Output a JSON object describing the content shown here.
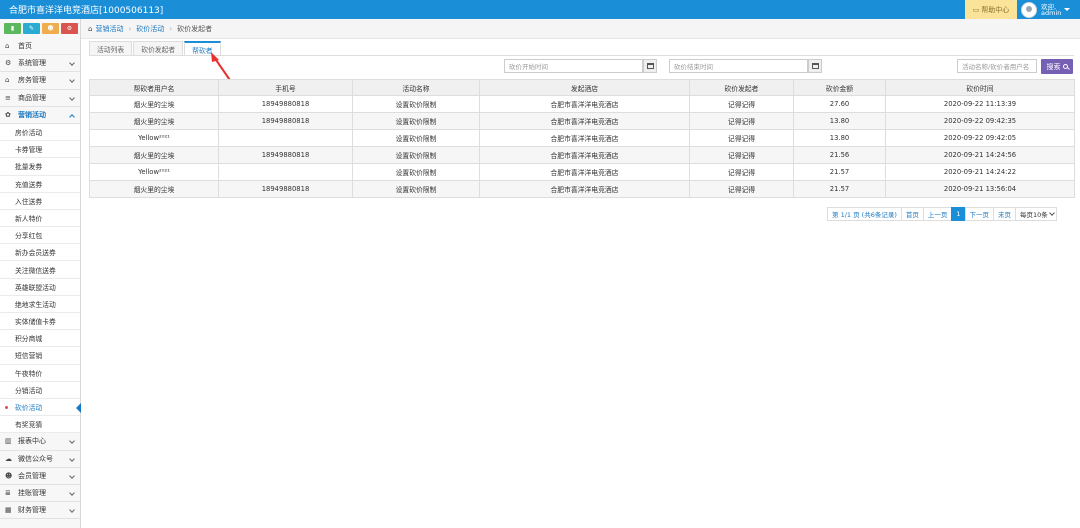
{
  "app": {
    "title": "合肥市喜洋洋电竞酒店[1000506113]"
  },
  "topbar": {
    "help_label": "帮助中心",
    "welcome": "欢迎,",
    "username": "admin"
  },
  "sidebar": {
    "quick_buttons": [
      {
        "icon": "chart-icon",
        "glyph": "▮",
        "color": "#5cb85c"
      },
      {
        "icon": "pencil-icon",
        "glyph": "✎",
        "color": "#2aabd2"
      },
      {
        "icon": "users-icon",
        "glyph": "☻",
        "color": "#f0ad4e"
      },
      {
        "icon": "gears-icon",
        "glyph": "⚙",
        "color": "#d9534f"
      }
    ],
    "top_items": [
      {
        "label": "首页",
        "icon": "home-icon",
        "glyph": "⌂",
        "has_caret": false
      },
      {
        "label": "系统管理",
        "icon": "gear-icon",
        "glyph": "⚙",
        "has_caret": true
      },
      {
        "label": "房务管理",
        "icon": "bank-icon",
        "glyph": "⌂",
        "has_caret": true
      },
      {
        "label": "商品管理",
        "icon": "list-icon",
        "glyph": "≡",
        "has_caret": true
      },
      {
        "label": "营销活动",
        "icon": "gift-icon",
        "glyph": "✿",
        "has_caret": true,
        "active": true
      }
    ],
    "sub_items": [
      {
        "label": "房价活动"
      },
      {
        "label": "卡券管理"
      },
      {
        "label": "批量发券"
      },
      {
        "label": "充值送券"
      },
      {
        "label": "入住送券"
      },
      {
        "label": "新人特价"
      },
      {
        "label": "分享红包"
      },
      {
        "label": "新办会员送券"
      },
      {
        "label": "关注微信送券"
      },
      {
        "label": "英雄联盟活动"
      },
      {
        "label": "绝地求生活动"
      },
      {
        "label": "实体储值卡券"
      },
      {
        "label": "积分商城"
      },
      {
        "label": "短信营销"
      },
      {
        "label": "午夜特价"
      },
      {
        "label": "分销活动"
      },
      {
        "label": "砍价活动",
        "active": true
      },
      {
        "label": "有奖竞猜"
      }
    ],
    "bottom_items": [
      {
        "label": "报表中心",
        "icon": "bar-chart-icon",
        "glyph": "▥",
        "has_caret": true
      },
      {
        "label": "微信公众号",
        "icon": "cloud-icon",
        "glyph": "☁",
        "has_caret": true
      },
      {
        "label": "会员管理",
        "icon": "group-icon",
        "glyph": "☻",
        "has_caret": true
      },
      {
        "label": "挂账管理",
        "icon": "list-icon",
        "glyph": "≣",
        "has_caret": true
      },
      {
        "label": "财务管理",
        "icon": "building-icon",
        "glyph": "▦",
        "has_caret": true
      }
    ]
  },
  "breadcrumb": {
    "items": [
      "营销活动",
      "砍价活动",
      "砍价发起者"
    ]
  },
  "tabs": [
    {
      "label": "活动列表"
    },
    {
      "label": "砍价发起者"
    },
    {
      "label": "帮砍者",
      "active": true
    }
  ],
  "filters": {
    "start_placeholder": "砍价开始时间",
    "end_placeholder": "砍价结束时间",
    "keyword_placeholder": "活动名称/砍价者用户名",
    "search_label": "搜索"
  },
  "table": {
    "headers": [
      "帮砍者用户名",
      "手机号",
      "活动名称",
      "发起酒店",
      "砍价发起者",
      "砍价金额",
      "砍价时间"
    ],
    "rows": [
      [
        "烟火里的尘埃",
        "18949880818",
        "设置砍价限制",
        "合肥市喜洋洋电竞酒店",
        "记得记得",
        "27.60",
        "2020-09-22 11:13:39"
      ],
      [
        "烟火里的尘埃",
        "18949880818",
        "设置砍价限制",
        "合肥市喜洋洋电竞酒店",
        "记得记得",
        "13.80",
        "2020-09-22 09:42:35"
      ],
      [
        "Yellow²⁰²¹",
        "",
        "设置砍价限制",
        "合肥市喜洋洋电竞酒店",
        "记得记得",
        "13.80",
        "2020-09-22 09:42:05"
      ],
      [
        "烟火里的尘埃",
        "18949880818",
        "设置砍价限制",
        "合肥市喜洋洋电竞酒店",
        "记得记得",
        "21.56",
        "2020-09-21 14:24:56"
      ],
      [
        "Yellow²⁰²¹",
        "",
        "设置砍价限制",
        "合肥市喜洋洋电竞酒店",
        "记得记得",
        "21.57",
        "2020-09-21 14:24:22"
      ],
      [
        "烟火里的尘埃",
        "18949880818",
        "设置砍价限制",
        "合肥市喜洋洋电竞酒店",
        "记得记得",
        "21.57",
        "2020-09-21 13:56:04"
      ]
    ]
  },
  "pager": {
    "info": "第 1/1 页 (共6条记录)",
    "first": "首页",
    "prev": "上一页",
    "current": "1",
    "next": "下一页",
    "last": "末页",
    "page_size": "每页10条"
  },
  "colors": {
    "primary": "#1a8fd8",
    "help_bg": "#fbe39a",
    "search_button": "#7560b4",
    "annotation_arrow": "#e8322d"
  }
}
